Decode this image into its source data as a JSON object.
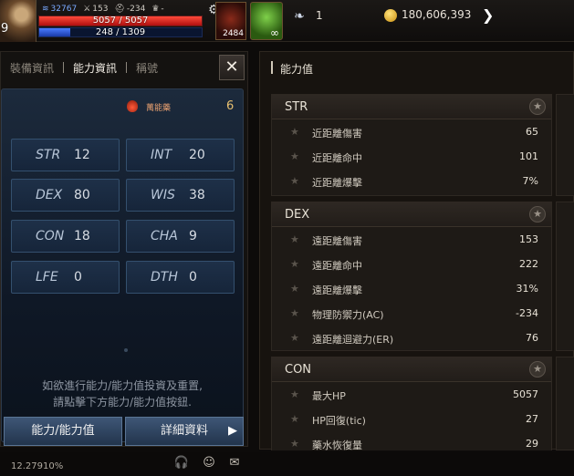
{
  "hud": {
    "level": "9",
    "stat1": "32767",
    "stat2": "153",
    "stat3": "-234",
    "stat4": "-",
    "hp_text": "5057 / 5057",
    "hp_fraction": 1.0,
    "mp_text": "248 / 1309",
    "mp_fraction": 0.19,
    "potion_count": "2484",
    "leaf_symbol": "∞",
    "feather_count": "1",
    "gold": "180,606,393",
    "arrow": "❯"
  },
  "tabs": [
    {
      "label": "裝備資訊",
      "active": false
    },
    {
      "label": "能力資訊",
      "active": true
    },
    {
      "label": "稱號",
      "active": false
    }
  ],
  "close_symbol": "✕",
  "bonus": {
    "label": "萬能藥",
    "value": "6"
  },
  "stats": [
    {
      "name": "STR",
      "value": "12"
    },
    {
      "name": "INT",
      "value": "20"
    },
    {
      "name": "DEX",
      "value": "80"
    },
    {
      "name": "WIS",
      "value": "38"
    },
    {
      "name": "CON",
      "value": "18"
    },
    {
      "name": "CHA",
      "value": "9"
    },
    {
      "name": "LFE",
      "value": "0"
    },
    {
      "name": "DTH",
      "value": "0"
    }
  ],
  "note_line1": "如欲進行能力/能力值投資及重置,",
  "note_line2": "請點擊下方能力/能力值按鈕.",
  "buttons": {
    "ability": "能力/能力值",
    "details": "詳細資料",
    "details_arrow": "▶"
  },
  "right": {
    "title": "能力值",
    "sections": [
      {
        "title": "STR",
        "rows": [
          {
            "label": "近距離傷害",
            "value": "65"
          },
          {
            "label": "近距離命中",
            "value": "101"
          },
          {
            "label": "近距離爆擊",
            "value": "7%"
          }
        ]
      },
      {
        "title": "DEX",
        "rows": [
          {
            "label": "遠距離傷害",
            "value": "153"
          },
          {
            "label": "遠距離命中",
            "value": "222"
          },
          {
            "label": "遠距離爆擊",
            "value": "31%"
          },
          {
            "label": "物理防禦力(AC)",
            "value": "-234"
          },
          {
            "label": "遠距離迴避力(ER)",
            "value": "76"
          }
        ]
      },
      {
        "title": "CON",
        "rows": [
          {
            "label": "最大HP",
            "value": "5057"
          },
          {
            "label": "HP回復(tic)",
            "value": "27"
          },
          {
            "label": "藥水恢復量",
            "value": "29"
          }
        ]
      }
    ]
  },
  "bottom": {
    "exp": "12.27910%"
  }
}
